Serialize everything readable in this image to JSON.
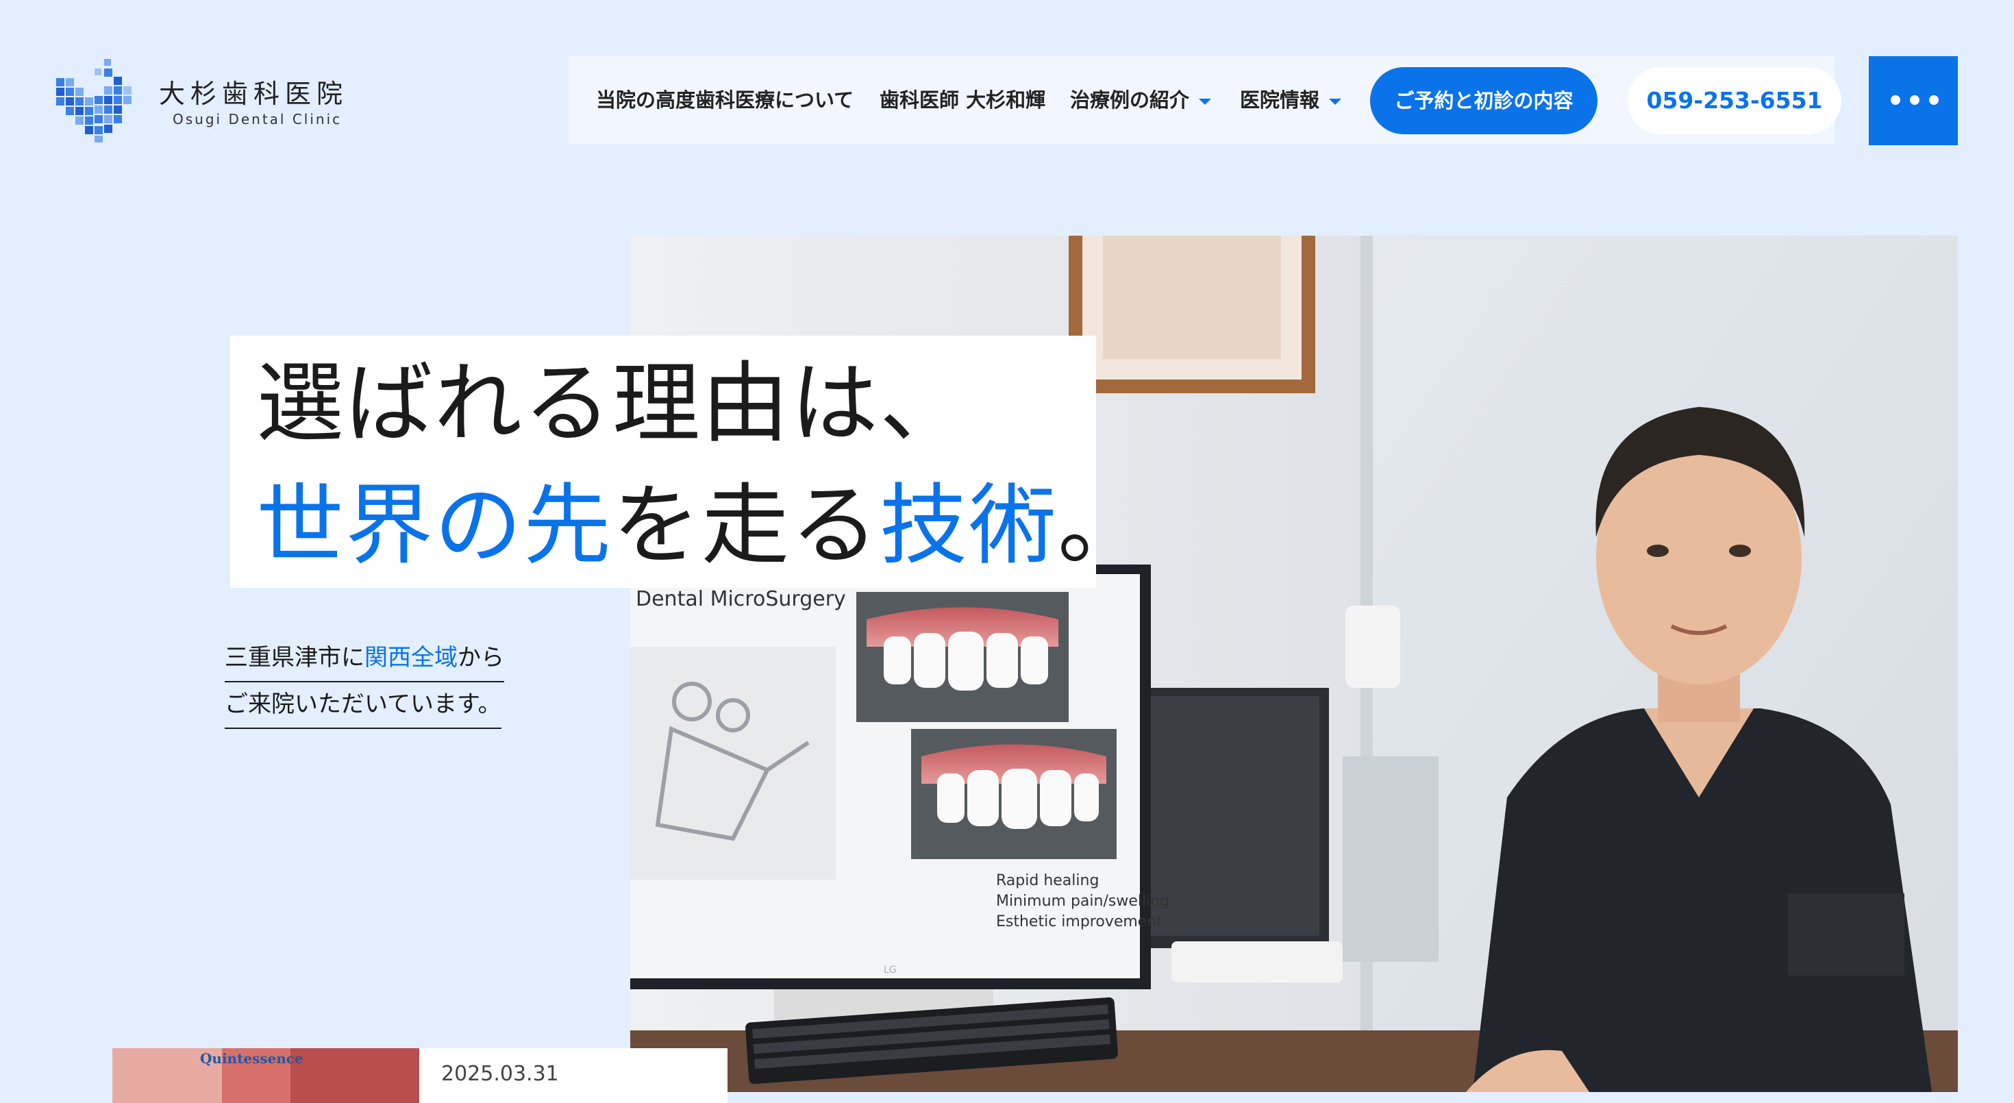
{
  "logo": {
    "name_jp": "大杉歯科医院",
    "name_en": "Osugi Dental Clinic"
  },
  "nav": {
    "items": [
      {
        "label": "当院の高度歯科医療について",
        "has_dropdown": false
      },
      {
        "label": "歯科医師 大杉和輝",
        "has_dropdown": false
      },
      {
        "label": "治療例の紹介",
        "has_dropdown": true
      },
      {
        "label": "医院情報",
        "has_dropdown": true
      }
    ],
    "reserve_label": "ご予約と初診の内容",
    "phone": "059-253-6551",
    "menu_icon": "more-dots-icon"
  },
  "hero": {
    "headline_line1": "選ばれる理由は、",
    "headline_line2": {
      "part1": "世界の先",
      "part2": "を走る",
      "part3": "技術",
      "part4": "。"
    },
    "sub_line1": {
      "part1": "三重県津市に",
      "part2": "関西全域",
      "part3": "から"
    },
    "sub_line2": "ご来院いただいています。",
    "monitor_slide": {
      "title": "Dental MicroSurgery",
      "bullets": [
        "Rapid healing",
        "Minimum pain/swelling",
        "Esthetic improvement"
      ]
    },
    "monitor_brand": "LG"
  },
  "news": {
    "thumb_label": "Quintessence",
    "date": "2025.03.31"
  },
  "colors": {
    "page_bg": "#e3efff",
    "accent": "#0a73ea",
    "text": "#1b1b1b"
  }
}
